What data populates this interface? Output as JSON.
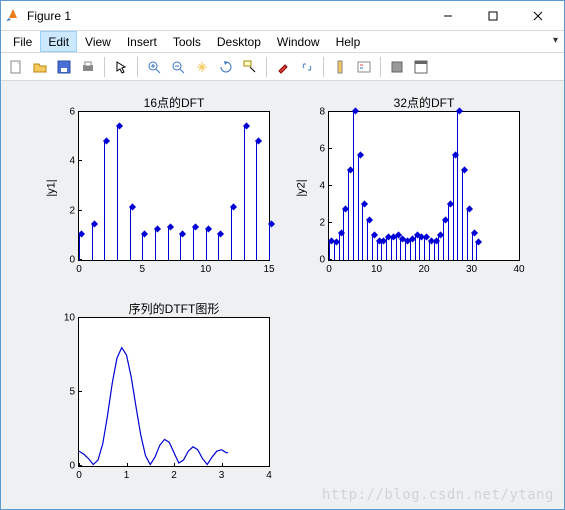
{
  "window": {
    "title": "Figure 1"
  },
  "menu": {
    "items": [
      "File",
      "Edit",
      "View",
      "Insert",
      "Tools",
      "Desktop",
      "Window",
      "Help"
    ],
    "active_index": 1
  },
  "toolbar": {
    "icons": [
      "new-icon",
      "open-icon",
      "save-icon",
      "print-icon",
      "pointer-icon",
      "zoom-in-icon",
      "zoom-out-icon",
      "pan-icon",
      "rotate-icon",
      "data-cursor-icon",
      "brush-icon",
      "link-icon",
      "colorbar-icon",
      "legend-icon",
      "hide-tools-icon",
      "dock-icon"
    ]
  },
  "watermark": "http://blog.csdn.net/ytang",
  "chart_data": [
    {
      "id": "ax1",
      "type": "stem",
      "title": "16点的DFT",
      "ylabel": "|y1|",
      "xlim": [
        0,
        15
      ],
      "xticks": [
        0,
        5,
        10,
        15
      ],
      "ylim": [
        0,
        6
      ],
      "yticks": [
        0,
        2,
        4,
        6
      ],
      "x": [
        0,
        1,
        2,
        3,
        4,
        5,
        6,
        7,
        8,
        9,
        10,
        11,
        12,
        13,
        14,
        15
      ],
      "values": [
        1.0,
        1.4,
        4.8,
        5.4,
        2.1,
        1.0,
        1.2,
        1.3,
        1.0,
        1.3,
        1.2,
        1.0,
        2.1,
        5.4,
        4.8,
        1.4
      ]
    },
    {
      "id": "ax2",
      "type": "stem",
      "title": "32点的DFT",
      "ylabel": "|y2|",
      "xlim": [
        0,
        40
      ],
      "xticks": [
        0,
        10,
        20,
        30,
        40
      ],
      "ylim": [
        0,
        8
      ],
      "yticks": [
        0,
        2,
        4,
        6,
        8
      ],
      "x": [
        0,
        1,
        2,
        3,
        4,
        5,
        6,
        7,
        8,
        9,
        10,
        11,
        12,
        13,
        14,
        15,
        16,
        17,
        18,
        19,
        20,
        21,
        22,
        23,
        24,
        25,
        26,
        27,
        28,
        29,
        30,
        31
      ],
      "values": [
        1.0,
        0.9,
        1.4,
        2.7,
        4.8,
        8.0,
        5.6,
        3.0,
        2.1,
        1.3,
        1.0,
        1.0,
        1.2,
        1.2,
        1.3,
        1.1,
        1.0,
        1.1,
        1.3,
        1.2,
        1.2,
        1.0,
        1.0,
        1.3,
        2.1,
        3.0,
        5.6,
        8.0,
        4.8,
        2.7,
        1.4,
        0.9
      ]
    },
    {
      "id": "ax3",
      "type": "line",
      "title": "序列的DTFT图形",
      "ylabel": "",
      "xlim": [
        0,
        4
      ],
      "xticks": [
        0,
        1,
        2,
        3,
        4
      ],
      "ylim": [
        0,
        10
      ],
      "yticks": [
        0,
        5,
        10
      ],
      "line": {
        "note": "abs(DTFT) magnitude curve over [0, π]",
        "x": [
          0,
          0.1,
          0.2,
          0.3,
          0.4,
          0.5,
          0.6,
          0.7,
          0.8,
          0.9,
          1.0,
          1.1,
          1.2,
          1.3,
          1.4,
          1.5,
          1.6,
          1.7,
          1.8,
          1.9,
          2.0,
          2.1,
          2.2,
          2.3,
          2.4,
          2.5,
          2.6,
          2.7,
          2.8,
          2.9,
          3.0,
          3.1,
          3.14
        ],
        "y": [
          1.0,
          0.8,
          0.5,
          0.1,
          0.4,
          1.5,
          3.4,
          5.6,
          7.3,
          8.0,
          7.5,
          6.0,
          4.0,
          2.1,
          0.7,
          0.1,
          0.6,
          1.4,
          1.8,
          1.6,
          0.9,
          0.2,
          0.4,
          1.0,
          1.3,
          1.1,
          0.5,
          0.1,
          0.6,
          1.0,
          1.1,
          0.9,
          0.9
        ]
      }
    }
  ]
}
